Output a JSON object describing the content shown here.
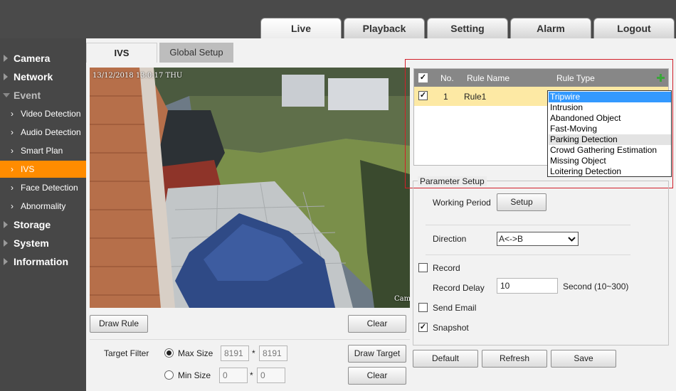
{
  "nav": {
    "tabs": [
      "Live",
      "Playback",
      "Setting",
      "Alarm",
      "Logout"
    ]
  },
  "sidebar": {
    "camera": "Camera",
    "network": "Network",
    "event": "Event",
    "event_items": [
      "Video Detection",
      "Audio Detection",
      "Smart Plan",
      "IVS",
      "Face Detection",
      "Abnormality"
    ],
    "storage": "Storage",
    "system": "System",
    "information": "Information"
  },
  "subtabs": {
    "ivs": "IVS",
    "global_setup": "Global Setup"
  },
  "video": {
    "timestamp": "13/12/2018 13:0:17 THU",
    "channel": "Cam"
  },
  "left_controls": {
    "draw_rule": "Draw Rule",
    "clear": "Clear",
    "target_filter": "Target Filter",
    "max_size": "Max Size",
    "max_w": "8191",
    "max_h": "8191",
    "min_size": "Min Size",
    "min_w": "0",
    "min_h": "0",
    "times": "*",
    "draw_target": "Draw Target",
    "clear2": "Clear"
  },
  "rule_table": {
    "headers": {
      "no": "No.",
      "name": "Rule Name",
      "type": "Rule Type"
    },
    "rows": [
      {
        "no": "1",
        "name": "Rule1",
        "checked": true
      }
    ],
    "rule_type_options": [
      "Tripwire",
      "Intrusion",
      "Abandoned Object",
      "Fast-Moving",
      "Parking Detection",
      "Crowd Gathering Estimation",
      "Missing Object",
      "Loitering Detection"
    ],
    "selected_option": "Tripwire"
  },
  "param": {
    "legend": "Parameter Setup",
    "working_period": "Working Period",
    "setup": "Setup",
    "direction": "Direction",
    "direction_value": "A<->B",
    "record": "Record",
    "record_delay": "Record Delay",
    "record_delay_value": "10",
    "record_delay_unit": "Second (10~300)",
    "send_email": "Send Email",
    "snapshot": "Snapshot",
    "record_checked": false,
    "send_email_checked": false,
    "snapshot_checked": true
  },
  "footer": {
    "default": "Default",
    "refresh": "Refresh",
    "save": "Save"
  },
  "colors": {
    "accent": "#ff8c00",
    "row_highlight": "#fde9a4",
    "callout": "#d21f2a",
    "selection": "#3399ff",
    "add_icon": "#3aa63a"
  }
}
